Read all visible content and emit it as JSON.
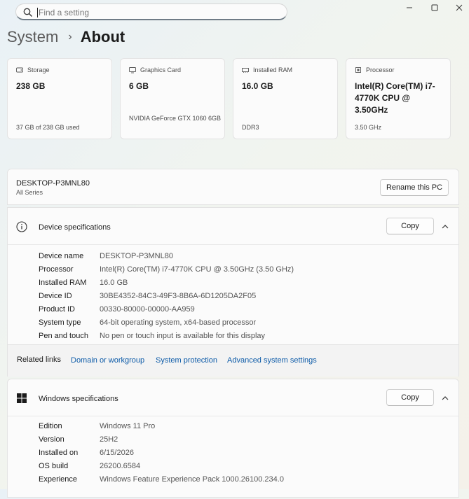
{
  "search": {
    "placeholder": "Find a setting"
  },
  "header": {
    "breadcrumb_parent": "System",
    "separator": "›",
    "title": "About"
  },
  "cards": [
    {
      "icon": "storage-icon",
      "label": "Storage",
      "value": "238 GB",
      "sub": "37 GB of 238 GB used"
    },
    {
      "icon": "graphics-card-icon",
      "label": "Graphics Card",
      "value": "6 GB",
      "sub": "NVIDIA GeForce GTX 1060 6GB"
    },
    {
      "icon": "ram-icon",
      "label": "Installed RAM",
      "value": "16.0 GB",
      "sub": "DDR3"
    },
    {
      "icon": "processor-icon",
      "label": "Processor",
      "value": "Intel(R) Core(TM) i7-4770K CPU @ 3.50GHz",
      "sub": "3.50 GHz"
    }
  ],
  "pc": {
    "name": "DESKTOP-P3MNL80",
    "series": "All Series",
    "rename_label": "Rename this PC"
  },
  "device_specs": {
    "title": "Device specifications",
    "copy_label": "Copy",
    "rows": [
      {
        "key": "Device name",
        "value": "DESKTOP-P3MNL80"
      },
      {
        "key": "Processor",
        "value": "Intel(R) Core(TM) i7-4770K CPU @ 3.50GHz (3.50 GHz)"
      },
      {
        "key": "Installed RAM",
        "value": "16.0 GB"
      },
      {
        "key": "Device ID",
        "value": "30BE4352-84C3-49F3-8B6A-6D1205DA2F05"
      },
      {
        "key": "Product ID",
        "value": "00330-80000-00000-AA959"
      },
      {
        "key": "System type",
        "value": "64-bit operating system, x64-based processor"
      },
      {
        "key": "Pen and touch",
        "value": "No pen or touch input is available for this display"
      }
    ]
  },
  "related": {
    "label": "Related links",
    "links": [
      "Domain or workgroup",
      "System protection",
      "Advanced system settings"
    ]
  },
  "windows_specs": {
    "title": "Windows specifications",
    "copy_label": "Copy",
    "rows": [
      {
        "key": "Edition",
        "value": "Windows 11 Pro"
      },
      {
        "key": "Version",
        "value": "25H2"
      },
      {
        "key": "Installed on",
        "value": "6/15/2026"
      },
      {
        "key": "OS build",
        "value": "26200.6584"
      },
      {
        "key": "Experience",
        "value": "Windows Feature Experience Pack 1000.26100.234.0"
      }
    ]
  },
  "colors": {
    "link": "#0d5ba8",
    "accent_border": "#6f7b86"
  }
}
